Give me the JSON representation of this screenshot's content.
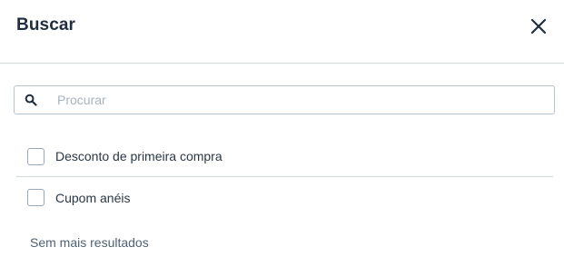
{
  "modal": {
    "title": "Buscar",
    "close_icon": "close-icon"
  },
  "search": {
    "placeholder": "Procurar",
    "value": "",
    "icon": "search-icon"
  },
  "results": [
    {
      "label": "Desconto de primeira compra",
      "checked": false
    },
    {
      "label": "Cupom anéis",
      "checked": false
    }
  ],
  "footer": {
    "no_more_results": "Sem mais resultados"
  },
  "colors": {
    "text": "#202e3f",
    "border": "#d1d7de",
    "checkbox_border": "#9aa8b8",
    "placeholder": "#a7b3c0",
    "muted_text": "#4f6275"
  }
}
